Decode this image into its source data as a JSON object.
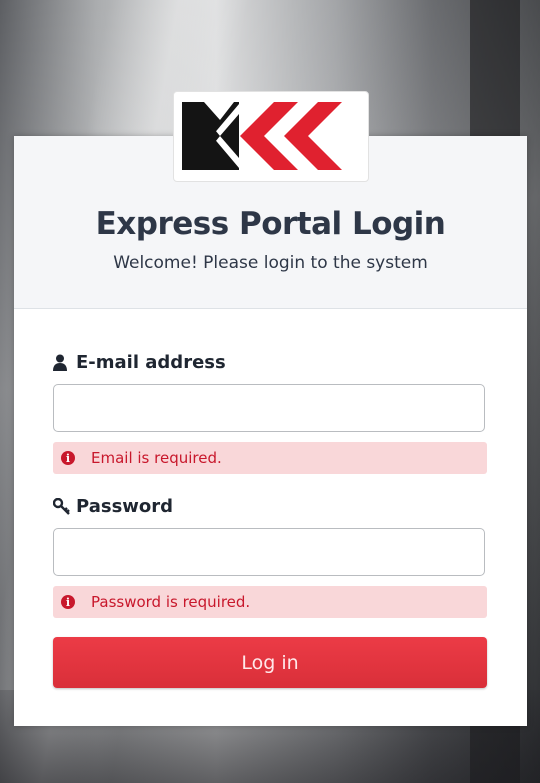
{
  "brand": {
    "logo_icon": "xkk-chevrons-logo",
    "colors": {
      "accent": "#e0212f",
      "dark": "#1a1a1a"
    }
  },
  "header": {
    "title": "Express Portal Login",
    "subtitle": "Welcome! Please login to the system"
  },
  "form": {
    "email": {
      "label": "E-mail address",
      "icon": "user-icon",
      "value": "",
      "placeholder": "",
      "error": "Email is required."
    },
    "password": {
      "label": "Password",
      "icon": "key-icon",
      "value": "",
      "placeholder": "",
      "error": "Password is required."
    },
    "submit_label": "Log in"
  },
  "colors": {
    "error_bg": "#f9d7d9",
    "error_text": "#c8182c",
    "button": "#e2353f"
  }
}
